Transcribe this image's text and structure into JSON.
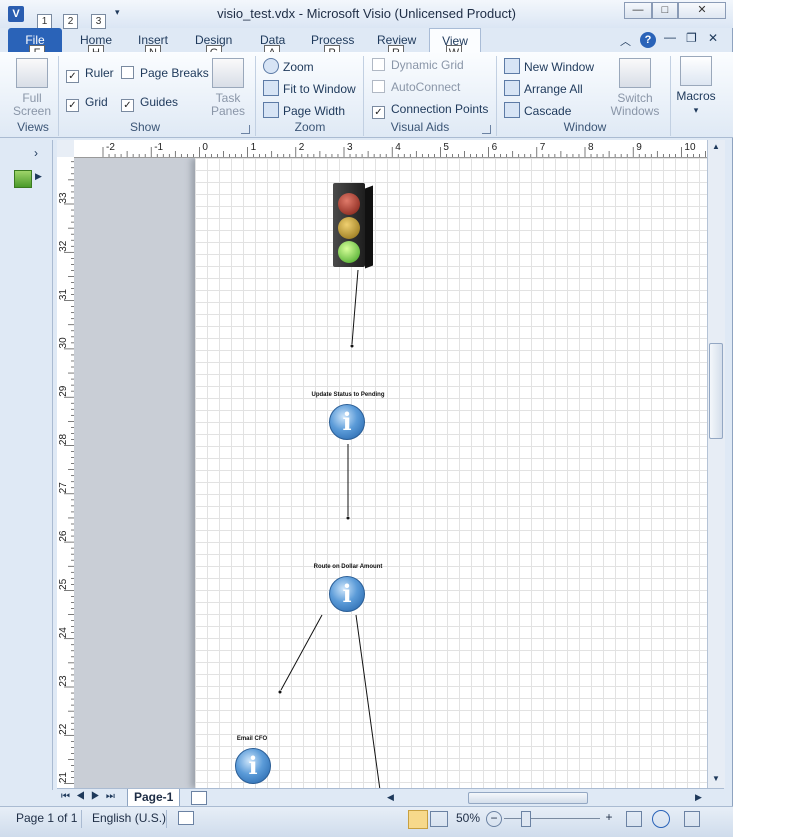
{
  "window": {
    "title": "visio_test.vdx  -  Microsoft Visio (Unlicensed Product)",
    "app_icon": "V",
    "qat_keys": [
      "1",
      "2",
      "3"
    ],
    "controls": {
      "minimize": "—",
      "maximize": "□",
      "close": "✕"
    }
  },
  "tabs": [
    {
      "label": "File",
      "key": "F"
    },
    {
      "label": "Home",
      "key": "H"
    },
    {
      "label": "Insert",
      "key": "N"
    },
    {
      "label": "Design",
      "key": "G"
    },
    {
      "label": "Data",
      "key": "A"
    },
    {
      "label": "Process",
      "key": "P"
    },
    {
      "label": "Review",
      "key": "R"
    },
    {
      "label": "View",
      "key": "W"
    }
  ],
  "ribbon": {
    "views": {
      "label": "Views",
      "full_screen": "Full Screen"
    },
    "show": {
      "label": "Show",
      "ruler": "Ruler",
      "page_breaks": "Page Breaks",
      "grid": "Grid",
      "guides": "Guides",
      "task_panes": "Task Panes"
    },
    "zoom": {
      "label": "Zoom",
      "zoom": "Zoom",
      "fit_to_window": "Fit to Window",
      "page_width": "Page Width"
    },
    "visual_aids": {
      "label": "Visual Aids",
      "dynamic_grid": "Dynamic Grid",
      "autoconnect": "AutoConnect",
      "connection_points": "Connection Points"
    },
    "window": {
      "label": "Window",
      "new_window": "New Window",
      "arrange_all": "Arrange All",
      "cascade": "Cascade",
      "switch_windows": "Switch Windows"
    },
    "macros": {
      "label": "Macros"
    }
  },
  "ruler": {
    "h_ticks": [
      "-2",
      "-1",
      "0",
      "1",
      "2",
      "3",
      "4",
      "5",
      "6",
      "7",
      "8",
      "9",
      "10"
    ],
    "v_ticks": [
      "33",
      "32",
      "31",
      "30",
      "29",
      "28",
      "27",
      "26",
      "25",
      "24",
      "23",
      "22",
      "21"
    ]
  },
  "diagram": {
    "shapes": [
      {
        "label": "Update Status to Pending"
      },
      {
        "label": "Route on Dollar Amount"
      },
      {
        "label": "Email CFO"
      }
    ]
  },
  "page_tab": "Page-1",
  "status": {
    "page": "Page 1 of 1",
    "language": "English (U.S.)",
    "zoom": "50%"
  }
}
